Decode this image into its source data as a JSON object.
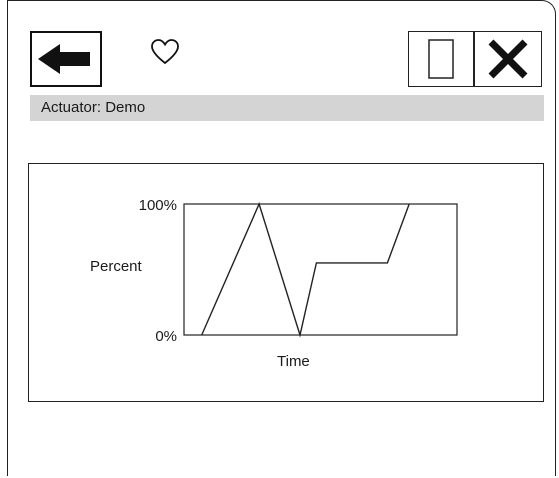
{
  "header": {
    "back_icon": "arrow-left-icon",
    "favorite_icon": "heart-outline-icon",
    "window_icon": "window-outline-icon",
    "close_icon": "close-x-icon"
  },
  "title_bar": {
    "label": "Actuator: Demo"
  },
  "chart_data": {
    "type": "line",
    "title": "",
    "xlabel": "Time",
    "ylabel": "Percent",
    "ylim": [
      0,
      100
    ],
    "xlim": [
      0,
      100
    ],
    "y_ticks": [
      "100%",
      "0%"
    ],
    "grid": false,
    "series": [
      {
        "x": [
          6.5,
          27.5,
          42.5,
          48.5,
          74.5,
          82.5
        ],
        "values": [
          0,
          100,
          0,
          55,
          55,
          100
        ]
      }
    ]
  }
}
